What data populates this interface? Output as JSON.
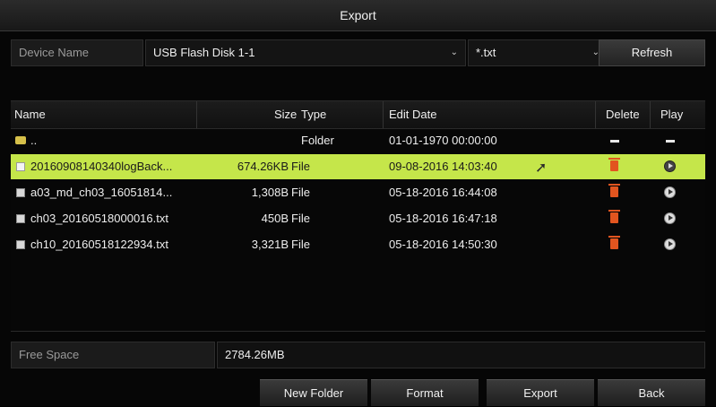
{
  "window": {
    "title": "Export"
  },
  "device": {
    "label": "Device Name",
    "value": "USB Flash Disk 1-1",
    "filter_value": "*.txt",
    "refresh_label": "Refresh"
  },
  "table": {
    "headers": {
      "name": "Name",
      "size": "Size",
      "type": "Type",
      "edit_date": "Edit Date",
      "delete": "Delete",
      "play": "Play"
    },
    "rows": [
      {
        "name": "..",
        "size": "",
        "type": "Folder",
        "date": "01-01-1970 00:00:00",
        "kind": "folder",
        "selected": false
      },
      {
        "name": "20160908140340logBack...",
        "size": "674.26KB",
        "type": "File",
        "date": "09-08-2016 14:03:40",
        "kind": "file",
        "selected": true
      },
      {
        "name": "a03_md_ch03_16051814...",
        "size": "1,308B",
        "type": "File",
        "date": "05-18-2016 16:44:08",
        "kind": "file",
        "selected": false
      },
      {
        "name": "ch03_20160518000016.txt",
        "size": "450B",
        "type": "File",
        "date": "05-18-2016 16:47:18",
        "kind": "file",
        "selected": false
      },
      {
        "name": "ch10_20160518122934.txt",
        "size": "3,321B",
        "type": "File",
        "date": "05-18-2016 14:50:30",
        "kind": "file",
        "selected": false
      }
    ]
  },
  "free_space": {
    "label": "Free Space",
    "value": "2784.26MB"
  },
  "buttons": {
    "new_folder": "New Folder",
    "format": "Format",
    "export": "Export",
    "back": "Back"
  },
  "colors": {
    "selected_row": "#c5e64a",
    "delete_icon": "#e2551f"
  },
  "icons": {
    "folder": "folder-up-icon",
    "file": "file-icon",
    "delete": "trash-icon",
    "play": "play-icon"
  }
}
